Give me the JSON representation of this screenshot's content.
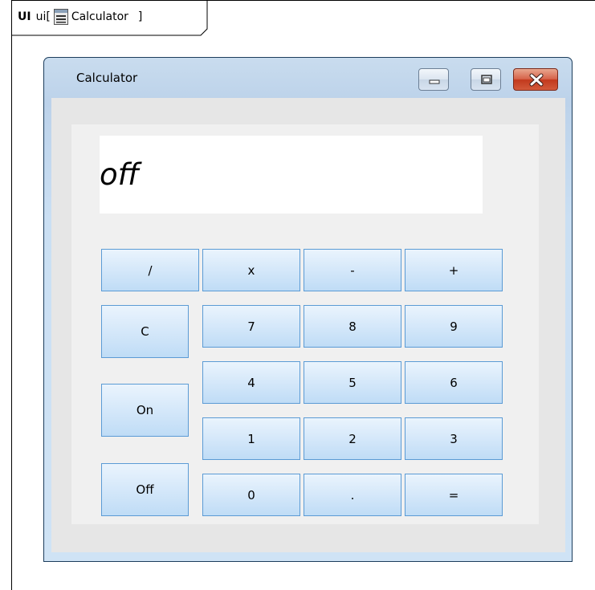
{
  "frame": {
    "keyword": "UI",
    "name": "ui",
    "bracket_open": "[",
    "element": "Calculator",
    "bracket_close": "]"
  },
  "window": {
    "title": "Calculator",
    "controls": [
      "minimize",
      "maximize",
      "close"
    ]
  },
  "display": {
    "value": "off"
  },
  "keys": {
    "divide": "/",
    "multiply": "x",
    "subtract": "-",
    "add": "+",
    "clear": "C",
    "seven": "7",
    "eight": "8",
    "nine": "9",
    "four": "4",
    "five": "5",
    "six": "6",
    "on": "On",
    "one": "1",
    "two": "2",
    "three": "3",
    "off": "Off",
    "zero": "0",
    "decimal": ".",
    "equals": "="
  },
  "colors": {
    "key_border": "#5b9bd5",
    "key_fill": "#d7e9fa",
    "window_frame": "#bcd2ea",
    "close_button": "#c2391d"
  },
  "icons": {
    "frame_element_icon": "window-form-icon"
  }
}
